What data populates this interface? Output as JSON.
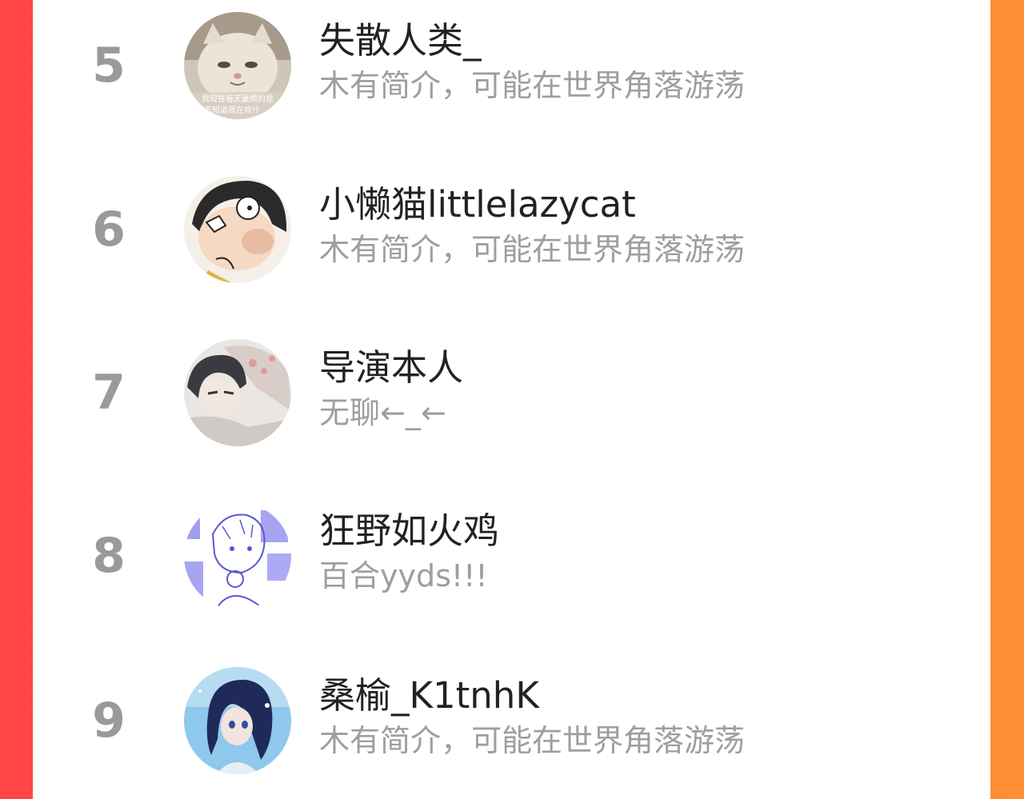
{
  "colors": {
    "background_left": "#ff4545",
    "background_right": "#ff8f34",
    "panel": "#ffffff",
    "rank_text": "#9a9a9a",
    "name_text": "#222222",
    "bio_text": "#9e9e9e"
  },
  "users": [
    {
      "rank": "5",
      "name": "失散人类_",
      "bio": "木有简介，可能在世界角落游荡",
      "avatar": {
        "icon": "cat-avatar-icon",
        "caption_line1": "我现在每天最烦的是",
        "caption_line2": "不知道我在烦什"
      }
    },
    {
      "rank": "6",
      "name": "小懒猫littlelazycat",
      "bio": "木有简介，可能在世界角落游荡",
      "avatar": {
        "icon": "comic-character-avatar-icon"
      }
    },
    {
      "rank": "7",
      "name": "导演本人",
      "bio": "无聊←_←",
      "avatar": {
        "icon": "anime-boy-avatar-icon"
      }
    },
    {
      "rank": "8",
      "name": "狂野如火鸡",
      "bio": "百合yyds!!!",
      "avatar": {
        "icon": "sketch-character-avatar-icon"
      }
    },
    {
      "rank": "9",
      "name": "桑榆_K1tnhK",
      "bio": "木有简介，可能在世界角落游荡",
      "avatar": {
        "icon": "anime-girl-avatar-icon"
      }
    }
  ]
}
